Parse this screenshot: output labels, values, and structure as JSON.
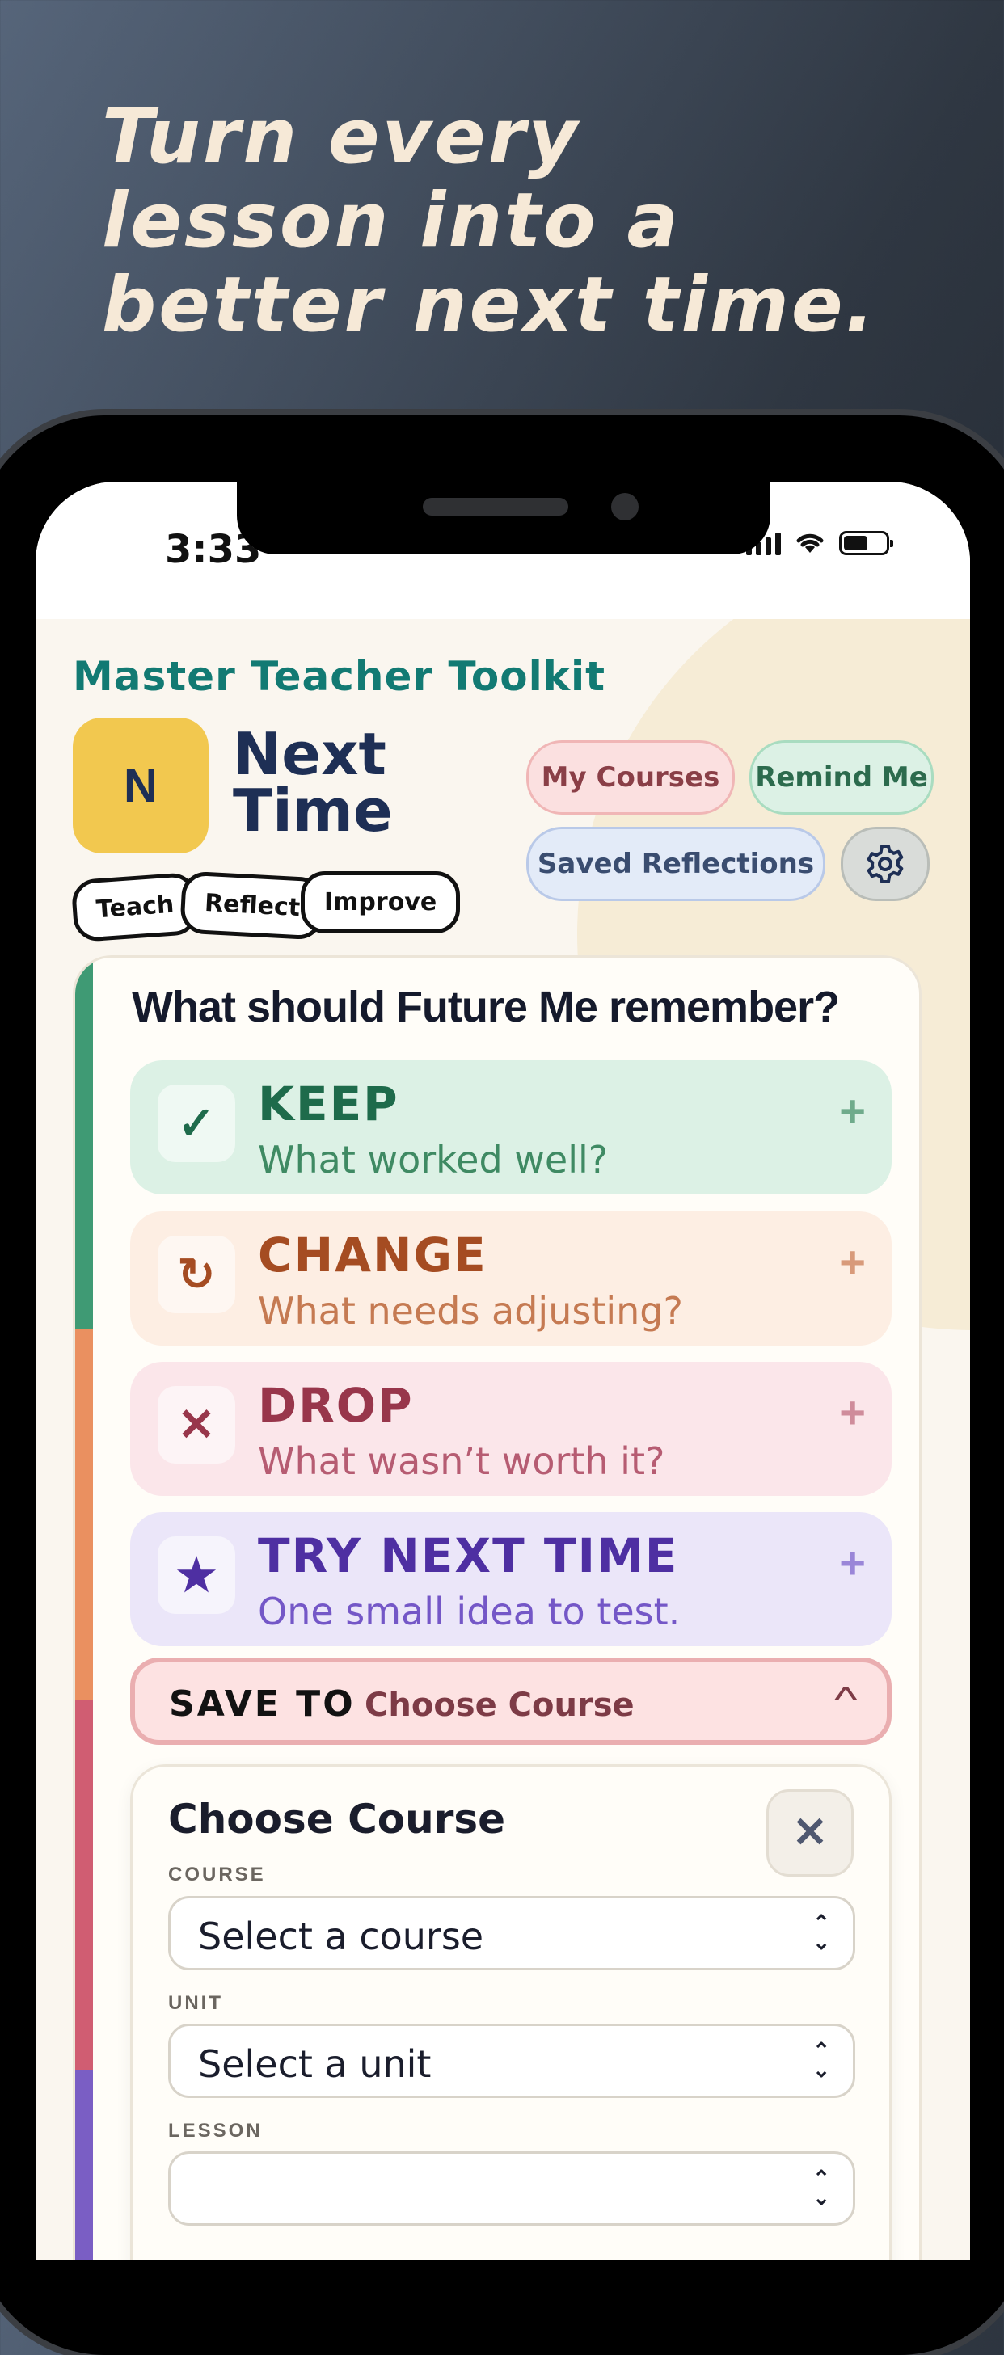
{
  "headline": {
    "line1": "Turn every",
    "line2": "lesson into a",
    "line3": "better next time."
  },
  "status_bar": {
    "time": "3:33",
    "battery_level": 0.58
  },
  "app": {
    "toolkit_title": "Master Teacher Toolkit",
    "logo_letter": "N",
    "name_line1": "Next",
    "name_line2": "Time",
    "tags": [
      "Teach",
      "Reflect",
      "Improve"
    ]
  },
  "nav": {
    "my_courses": "My Courses",
    "remind_me": "Remind Me",
    "saved_reflections": "Saved Reflections",
    "settings_icon": "gear-icon"
  },
  "reflection": {
    "question": "What should Future Me remember?",
    "items": [
      {
        "title": "KEEP",
        "subtitle": "What worked well?",
        "icon": "check-icon",
        "glyph": "✓",
        "plus": "+"
      },
      {
        "title": "CHANGE",
        "subtitle": "What needs adjusting?",
        "icon": "refresh-icon",
        "glyph": "↻",
        "plus": "+"
      },
      {
        "title": "DROP",
        "subtitle": "What wasn’t worth it?",
        "icon": "x-icon",
        "glyph": "✕",
        "plus": "+"
      },
      {
        "title": "TRY NEXT TIME",
        "subtitle": "One small idea to test.",
        "icon": "star-icon",
        "glyph": "★",
        "plus": "+"
      }
    ]
  },
  "save_to": {
    "label": "SAVE TO",
    "value": "Choose Course",
    "chevron": "^"
  },
  "choose_course": {
    "title": "Choose Course",
    "close": "✕",
    "course_label": "COURSE",
    "course_value": "Select a course",
    "unit_label": "UNIT",
    "unit_value": "Select a unit",
    "lesson_label": "LESSON",
    "arrows": "⌃⌄"
  },
  "colors": {
    "keep": "#3f9a74",
    "change": "#ea9060",
    "drop": "#d05d72",
    "try": "#7a5ec4",
    "brand_yellow": "#f2c84f",
    "brand_navy": "#1e2f55"
  }
}
